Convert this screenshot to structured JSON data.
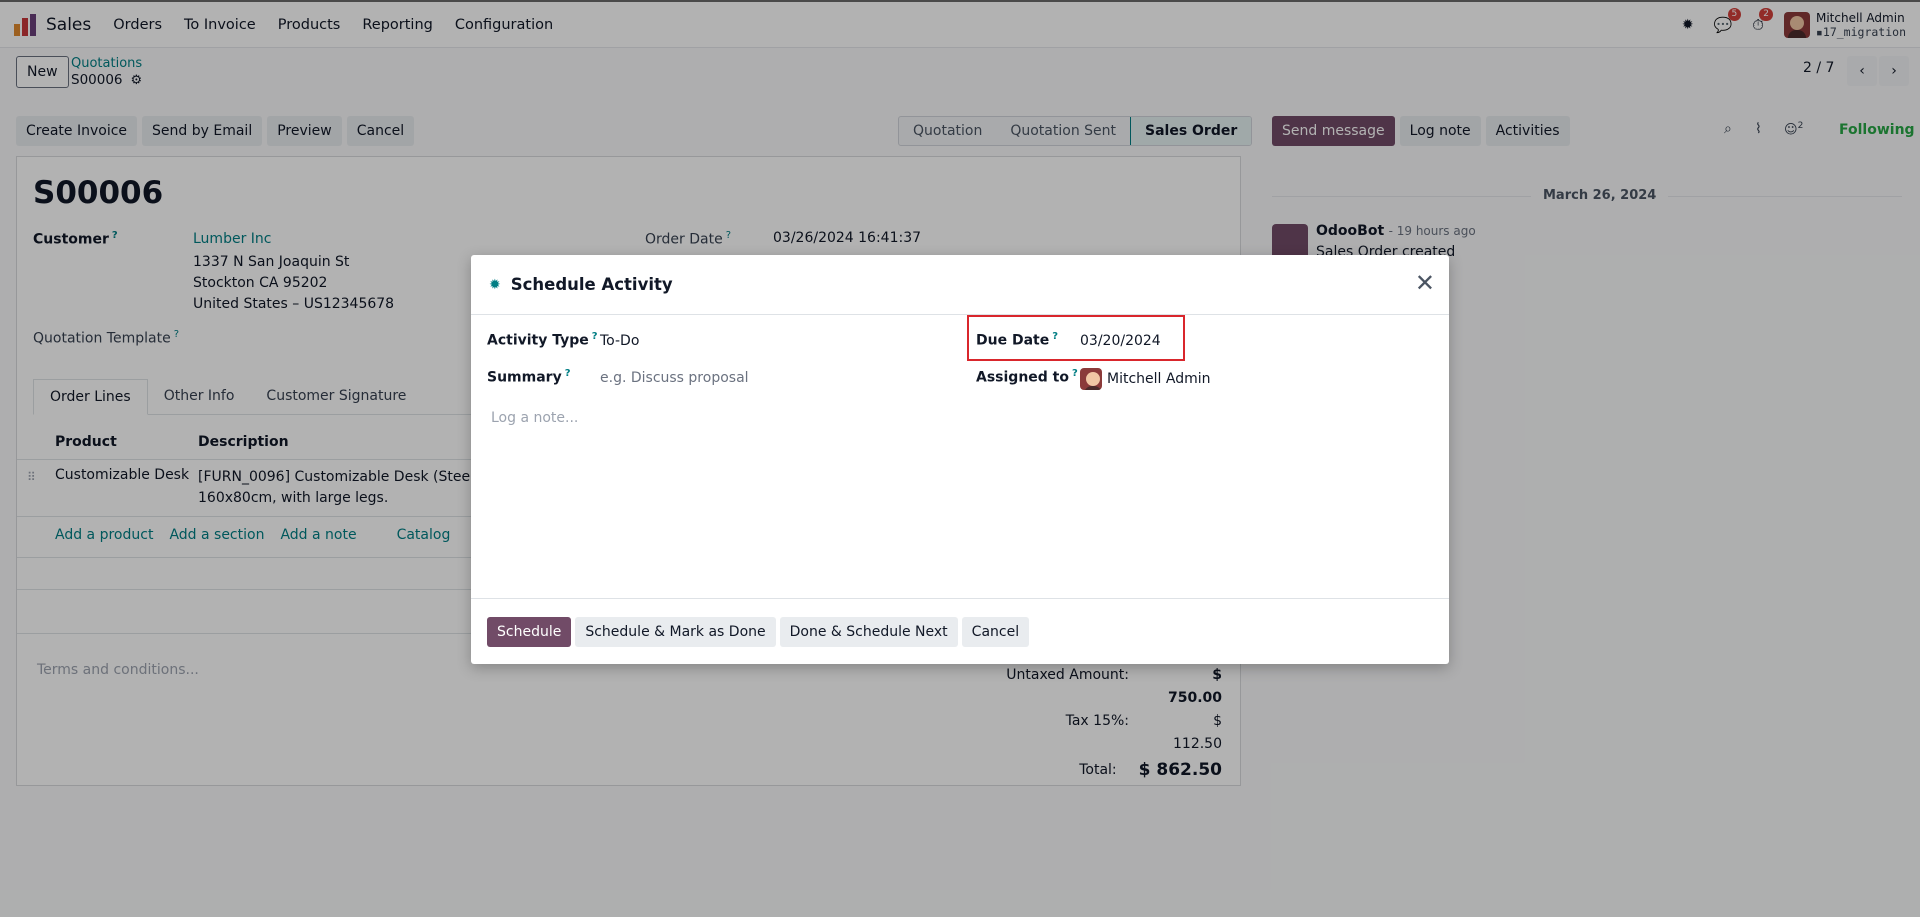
{
  "nav": {
    "app": "Sales",
    "menu": [
      "Orders",
      "To Invoice",
      "Products",
      "Reporting",
      "Configuration"
    ],
    "chat_count": "5",
    "activity_count": "2",
    "user_name": "Mitchell Admin",
    "db": "17_migration"
  },
  "control": {
    "new_label": "New",
    "breadcrumb_parent": "Quotations",
    "record": "S00006",
    "pager": "2 / 7"
  },
  "actions": [
    "Create Invoice",
    "Send by Email",
    "Preview",
    "Cancel"
  ],
  "status": [
    "Quotation",
    "Quotation Sent",
    "Sales Order"
  ],
  "form": {
    "name": "S00006",
    "customer_label": "Customer",
    "customer": "Lumber Inc",
    "address": [
      "1337 N San Joaquin St",
      "Stockton CA 95202",
      "United States – US12345678"
    ],
    "order_date_label": "Order Date",
    "order_date": "03/26/2024 16:41:37",
    "template_label": "Quotation Template",
    "tabs": [
      "Order Lines",
      "Other Info",
      "Customer Signature"
    ],
    "cols": {
      "product": "Product",
      "description": "Description"
    },
    "line": {
      "product": "Customizable Desk",
      "desc1": "[FURN_0096] Customizable Desk (Steel, Wh",
      "desc2": "160x80cm, with large legs."
    },
    "add_links": [
      "Add a product",
      "Add a section",
      "Add a note",
      "Catalog"
    ],
    "terms": "Terms and conditions...",
    "untaxed_label": "Untaxed Amount:",
    "untaxed": "$ 750.00",
    "tax_label": "Tax 15%:",
    "tax": "$ 112.50",
    "total_label": "Total:",
    "total": "$ 862.50"
  },
  "chatter": {
    "send": "Send message",
    "log": "Log note",
    "activities": "Activities",
    "followers": "2",
    "following": "Following",
    "date": "March 26, 2024",
    "author": "OdooBot",
    "time": "- 19 hours ago",
    "message": "Sales Order created"
  },
  "modal": {
    "title": "Schedule Activity",
    "activity_type_label": "Activity Type",
    "activity_type": "To-Do",
    "summary_label": "Summary",
    "summary_placeholder": "e.g. Discuss proposal",
    "due_label": "Due Date",
    "due": "03/20/2024",
    "assigned_label": "Assigned to",
    "assigned": "Mitchell Admin",
    "note_placeholder": "Log a note...",
    "buttons": {
      "schedule": "Schedule",
      "mark_done": "Schedule & Mark as Done",
      "done_next": "Done & Schedule Next",
      "cancel": "Cancel"
    }
  },
  "colors": {
    "primary": "#714b67",
    "link": "#017e84",
    "highlight": "#d9262c"
  }
}
